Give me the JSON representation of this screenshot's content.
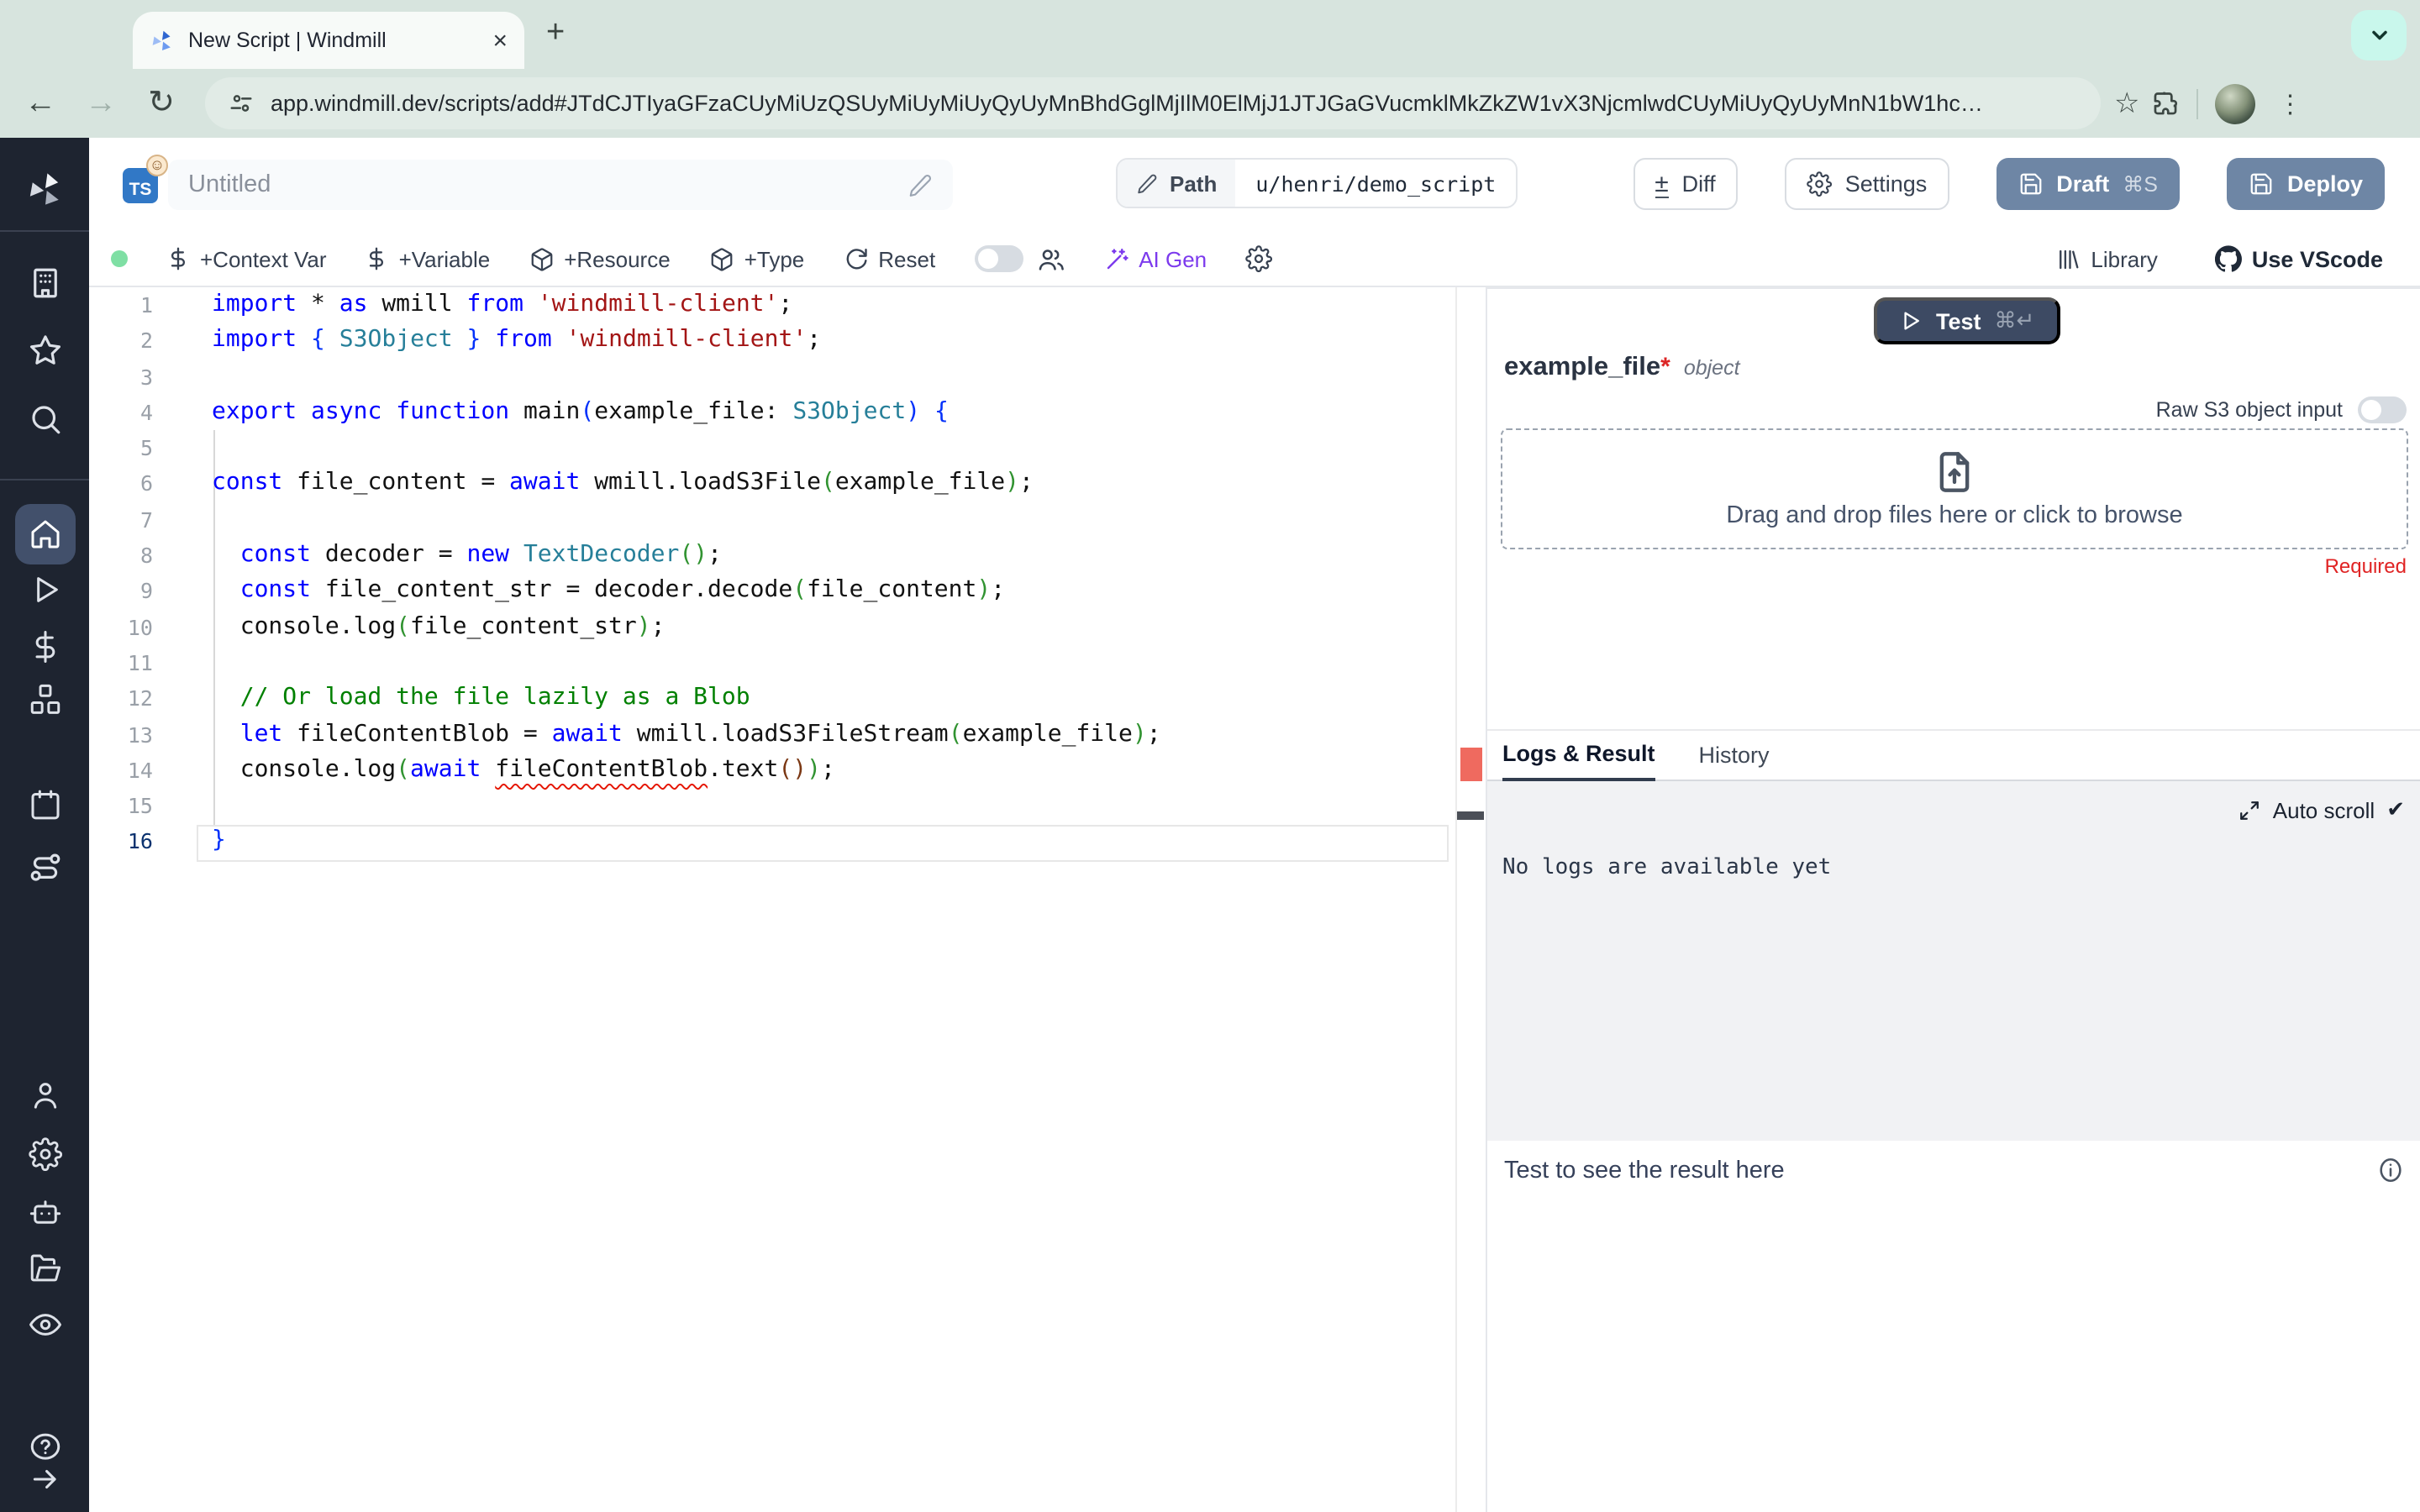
{
  "browser": {
    "tab_title": "New Script | Windmill",
    "url": "app.windmill.dev/scripts/add#JTdCJTIyaGFzaCUyMiUzQSUyMiUyMiUyQyUyMnBhdGglMjIlM0ElMjJ1JTJGaGVucmklMkZkZW1vX3NjcmlwdCUyMiUyQyUyMnN1bW1hc…",
    "glyphs": {
      "back": "←",
      "forward": "→",
      "reload": "↻",
      "close": "×",
      "new_tab": "+",
      "kebab": "⋮",
      "bookmark_star": "☆"
    }
  },
  "header": {
    "lang_badge": "TS",
    "badge_emoji": "☺",
    "title": "Untitled",
    "path_label": "Path",
    "path_value": "u/henri/demo_script",
    "diff_label": "Diff",
    "diff_glyph": "±",
    "settings_label": "Settings",
    "draft_label": "Draft",
    "draft_kbd": "⌘S",
    "deploy_label": "Deploy"
  },
  "toolbar": {
    "context_var": "+Context Var",
    "variable": "+Variable",
    "resource": "+Resource",
    "type": "+Type",
    "reset": "Reset",
    "ai_gen": "AI Gen",
    "library": "Library",
    "vscode": "Use VScode"
  },
  "editor": {
    "lines": [
      {
        "n": "1",
        "t": [
          [
            "k",
            "import"
          ],
          [
            "p",
            " * "
          ],
          [
            "k",
            "as"
          ],
          [
            "p",
            " wmill "
          ],
          [
            "k",
            "from"
          ],
          [
            "p",
            " "
          ],
          [
            "s",
            "'windmill-client'"
          ],
          [
            "p",
            ";"
          ]
        ]
      },
      {
        "n": "2",
        "t": [
          [
            "k",
            "import"
          ],
          [
            "p",
            " "
          ],
          [
            "b1",
            "{"
          ],
          [
            "p",
            " "
          ],
          [
            "t",
            "S3Object"
          ],
          [
            "p",
            " "
          ],
          [
            "b1",
            "}"
          ],
          [
            "p",
            " "
          ],
          [
            "k",
            "from"
          ],
          [
            "p",
            " "
          ],
          [
            "s",
            "'windmill-client'"
          ],
          [
            "p",
            ";"
          ]
        ]
      },
      {
        "n": "3",
        "t": []
      },
      {
        "n": "4",
        "t": [
          [
            "k",
            "export"
          ],
          [
            "p",
            " "
          ],
          [
            "k",
            "async"
          ],
          [
            "p",
            " "
          ],
          [
            "k",
            "function"
          ],
          [
            "p",
            " main"
          ],
          [
            "b1",
            "("
          ],
          [
            "p",
            "example_file: "
          ],
          [
            "t",
            "S3Object"
          ],
          [
            "b1",
            ")"
          ],
          [
            "p",
            " "
          ],
          [
            "b1",
            "{"
          ]
        ]
      },
      {
        "n": "5",
        "t": []
      },
      {
        "n": "6",
        "t": [
          [
            "k",
            "const"
          ],
          [
            "p",
            " file_content = "
          ],
          [
            "k",
            "await"
          ],
          [
            "p",
            " wmill.loadS3File"
          ],
          [
            "b2",
            "("
          ],
          [
            "p",
            "example_file"
          ],
          [
            "b2",
            ")"
          ],
          [
            "p",
            ";"
          ]
        ]
      },
      {
        "n": "7",
        "t": []
      },
      {
        "n": "8",
        "t": [
          [
            "p",
            "  "
          ],
          [
            "k",
            "const"
          ],
          [
            "p",
            " decoder = "
          ],
          [
            "k",
            "new"
          ],
          [
            "p",
            " "
          ],
          [
            "t",
            "TextDecoder"
          ],
          [
            "b2",
            "("
          ],
          [
            "b2",
            ")"
          ],
          [
            "p",
            ";"
          ]
        ]
      },
      {
        "n": "9",
        "t": [
          [
            "p",
            "  "
          ],
          [
            "k",
            "const"
          ],
          [
            "p",
            " file_content_str = decoder.decode"
          ],
          [
            "b2",
            "("
          ],
          [
            "p",
            "file_content"
          ],
          [
            "b2",
            ")"
          ],
          [
            "p",
            ";"
          ]
        ]
      },
      {
        "n": "10",
        "t": [
          [
            "p",
            "  console.log"
          ],
          [
            "b2",
            "("
          ],
          [
            "p",
            "file_content_str"
          ],
          [
            "b2",
            ")"
          ],
          [
            "p",
            ";"
          ]
        ]
      },
      {
        "n": "11",
        "t": []
      },
      {
        "n": "12",
        "t": [
          [
            "p",
            "  "
          ],
          [
            "c",
            "// Or load the file lazily as a Blob"
          ]
        ]
      },
      {
        "n": "13",
        "t": [
          [
            "p",
            "  "
          ],
          [
            "k",
            "let"
          ],
          [
            "p",
            " fileContentBlob = "
          ],
          [
            "k",
            "await"
          ],
          [
            "p",
            " wmill.loadS3FileStream"
          ],
          [
            "b2",
            "("
          ],
          [
            "p",
            "example_file"
          ],
          [
            "b2",
            ")"
          ],
          [
            "p",
            ";"
          ]
        ]
      },
      {
        "n": "14",
        "t": [
          [
            "p",
            "  console.log"
          ],
          [
            "b2",
            "("
          ],
          [
            "k",
            "await"
          ],
          [
            "p",
            " "
          ],
          [
            "e",
            "fileContentBlob"
          ],
          [
            "p",
            ".text"
          ],
          [
            "b3",
            "("
          ],
          [
            "b3",
            ")"
          ],
          [
            "b2",
            ")"
          ],
          [
            "p",
            ";"
          ]
        ],
        "error": "fileContentBlob underlined"
      },
      {
        "n": "15",
        "t": []
      },
      {
        "n": "16",
        "t": [
          [
            "b1",
            "}"
          ]
        ],
        "active": true
      }
    ]
  },
  "panel": {
    "test_label": "Test",
    "test_kbd": "⌘↵",
    "arg_name": "example_file",
    "arg_required_mark": "*",
    "arg_type": "object",
    "raw_s3_label": "Raw S3 object input",
    "dropzone_text": "Drag and drop files here or click to browse",
    "required_label": "Required",
    "tab_logs": "Logs & Result",
    "tab_history": "History",
    "auto_scroll_label": "Auto scroll",
    "auto_scroll_check": "✔",
    "no_logs_text": "No logs are available yet",
    "result_placeholder": "Test to see the result here"
  },
  "colors": {
    "chrome_bg": "#d7e4de",
    "tab_bg": "#f7faf8",
    "pill": "#e1ebe6",
    "mint": "#c9f7ec",
    "sidebar_bg": "#1e2430",
    "draft": "#6e86a5",
    "test": "#3d4a63",
    "ai": "#7c3aed",
    "green_dot": "#7fdfa4",
    "error_red": "#e51400",
    "required_red": "#e02424"
  }
}
